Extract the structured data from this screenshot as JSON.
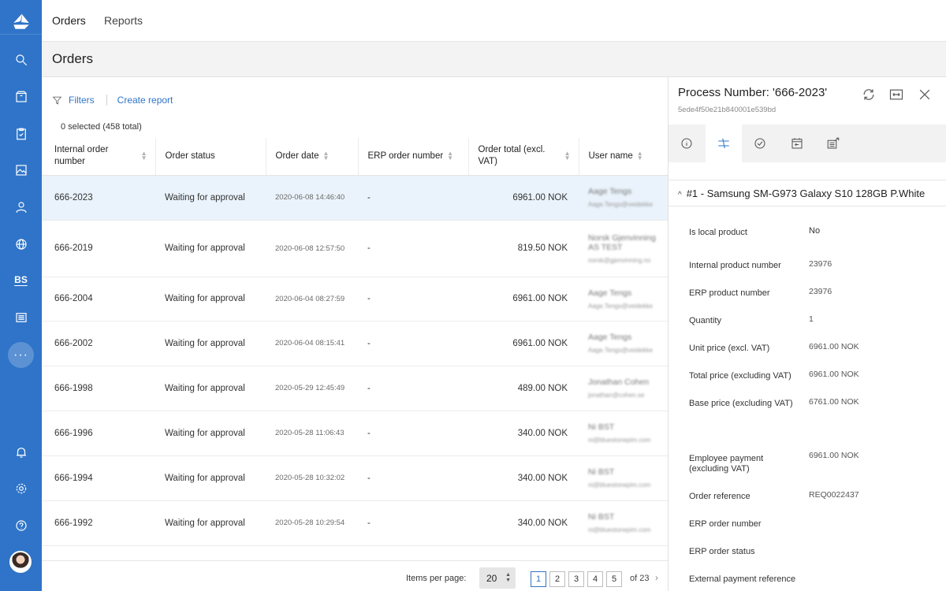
{
  "nav": {
    "tabs": [
      {
        "label": "Orders",
        "active": true
      },
      {
        "label": "Reports",
        "active": false
      }
    ]
  },
  "sidebar": {
    "bs_label": "BS",
    "more_label": "···"
  },
  "page": {
    "title": "Orders"
  },
  "toolbar": {
    "filters_label": "Filters",
    "create_report_label": "Create report"
  },
  "selection": {
    "text": "0 selected (458 total)"
  },
  "table": {
    "columns": [
      "Internal order number",
      "Order status",
      "Order date",
      "ERP order number",
      "Order total (excl. VAT)",
      "User name"
    ],
    "rows": [
      {
        "id": "666-2023",
        "status": "Waiting for approval",
        "date": "2020-06-08 14:46:40",
        "erp": "-",
        "total": "6961.00 NOK",
        "user": "Aage Tengs",
        "email": "Aage.Tengs@veidekke"
      },
      {
        "id": "666-2019",
        "status": "Waiting for approval",
        "date": "2020-06-08 12:57:50",
        "erp": "-",
        "total": "819.50 NOK",
        "user": "Norsk Gjenvinning AS TEST",
        "email": "norsk@gjenvinning.no"
      },
      {
        "id": "666-2004",
        "status": "Waiting for approval",
        "date": "2020-06-04 08:27:59",
        "erp": "-",
        "total": "6961.00 NOK",
        "user": "Aage Tengs",
        "email": "Aage.Tengs@veidekke"
      },
      {
        "id": "666-2002",
        "status": "Waiting for approval",
        "date": "2020-06-04 08:15:41",
        "erp": "-",
        "total": "6961.00 NOK",
        "user": "Aage Tengs",
        "email": "Aage.Tengs@veidekke"
      },
      {
        "id": "666-1998",
        "status": "Waiting for approval",
        "date": "2020-05-29 12:45:49",
        "erp": "-",
        "total": "489.00 NOK",
        "user": "Jonathan Cohen",
        "email": "jonathan@cohen.se"
      },
      {
        "id": "666-1996",
        "status": "Waiting for approval",
        "date": "2020-05-28 11:06:43",
        "erp": "-",
        "total": "340.00 NOK",
        "user": "Ni BST",
        "email": "ni@bluestonepim.com"
      },
      {
        "id": "666-1994",
        "status": "Waiting for approval",
        "date": "2020-05-28 10:32:02",
        "erp": "-",
        "total": "340.00 NOK",
        "user": "Ni BST",
        "email": "ni@bluestonepim.com"
      },
      {
        "id": "666-1992",
        "status": "Waiting for approval",
        "date": "2020-05-28 10:29:54",
        "erp": "-",
        "total": "340.00 NOK",
        "user": "Ni BST",
        "email": "ni@bluestonepim.com"
      }
    ]
  },
  "pagination": {
    "items_per_page_label": "Items per page:",
    "items_per_page": "20",
    "pages": [
      "1",
      "2",
      "3",
      "4",
      "5"
    ],
    "current_page": "1",
    "of_label": "of 23"
  },
  "panel": {
    "title": "Process Number: '666-2023'",
    "id": "5ede4f50e21b840001e539bd",
    "product_heading": "#1 - Samsung SM-G973 Galaxy S10 128GB P.White",
    "fields": [
      {
        "label": "Is local product",
        "value": "No"
      },
      {
        "label": "Internal product number",
        "value": "23976"
      },
      {
        "label": "ERP product number",
        "value": "23976"
      },
      {
        "label": "Quantity",
        "value": "1"
      },
      {
        "label": "Unit price (excl. VAT)",
        "value": "6961.00 NOK"
      },
      {
        "label": "Total price (excluding VAT)",
        "value": "6961.00 NOK"
      },
      {
        "label": "Base price (excluding VAT)",
        "value": "6761.00 NOK"
      },
      {
        "label": "Employee payment (excluding VAT)",
        "value": "6961.00 NOK"
      },
      {
        "label": "Order reference",
        "value": "REQ0022437"
      },
      {
        "label": "ERP order number",
        "value": ""
      },
      {
        "label": "ERP order status",
        "value": ""
      },
      {
        "label": "External payment reference",
        "value": ""
      }
    ]
  },
  "colors": {
    "sidebar": "#2f74c8",
    "accent": "#2f74c8",
    "highlight_row": "#eaf3fb"
  }
}
